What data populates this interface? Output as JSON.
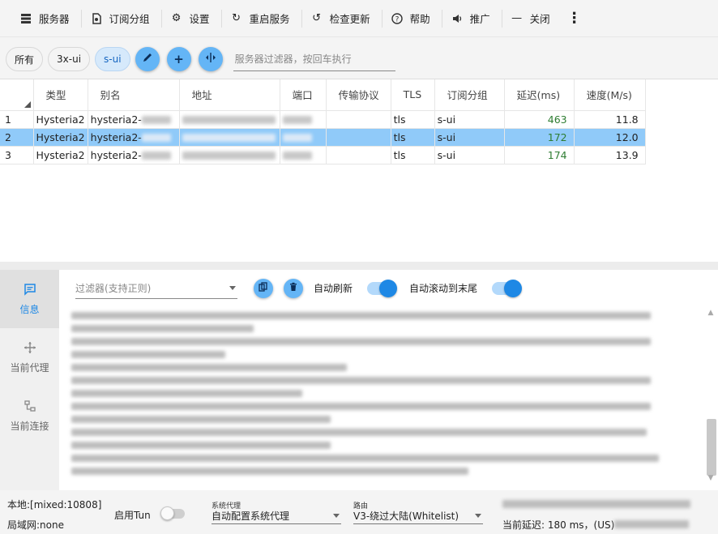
{
  "toolbar": {
    "items": [
      {
        "label": "服务器",
        "icon": "server-list-icon"
      },
      {
        "label": "订阅分组",
        "icon": "subscription-icon"
      },
      {
        "label": "设置",
        "icon": "gear-icon"
      },
      {
        "label": "重启服务",
        "icon": "restart-icon"
      },
      {
        "label": "检查更新",
        "icon": "update-icon"
      },
      {
        "label": "帮助",
        "icon": "help-icon"
      },
      {
        "label": "推广",
        "icon": "speaker-icon"
      },
      {
        "label": "关闭",
        "icon": "minus-icon"
      }
    ]
  },
  "chips": {
    "all": "所有",
    "g1": "3x-ui",
    "g2": "s-ui",
    "selected": "s-ui"
  },
  "server_filter": {
    "placeholder": "服务器过滤器，按回车执行"
  },
  "table": {
    "headers": [
      "类型",
      "别名",
      "地址",
      "端口",
      "传输协议",
      "TLS",
      "订阅分组",
      "延迟(ms)",
      "速度(M/s)"
    ],
    "rows": [
      {
        "no": "1",
        "type": "Hysteria2",
        "alias": "hysteria2-",
        "tls": "tls",
        "group": "s-ui",
        "latency": "463",
        "speed": "11.8"
      },
      {
        "no": "2",
        "type": "Hysteria2",
        "alias": "hysteria2-",
        "tls": "tls",
        "group": "s-ui",
        "latency": "172",
        "speed": "12.0"
      },
      {
        "no": "3",
        "type": "Hysteria2",
        "alias": "hysteria2-",
        "tls": "tls",
        "group": "s-ui",
        "latency": "174",
        "speed": "13.9"
      }
    ],
    "selected_row": 2
  },
  "sidenav": {
    "items": [
      {
        "label": "信息",
        "icon": "message-icon"
      },
      {
        "label": "当前代理",
        "icon": "proxy-icon"
      },
      {
        "label": "当前连接",
        "icon": "connection-icon"
      }
    ]
  },
  "log": {
    "filter_placeholder": "过滤器(支持正则)",
    "auto_refresh": "自动刷新",
    "auto_scroll": "自动滚动到末尾"
  },
  "status": {
    "local": "本地:[mixed:10808]",
    "lan": "局域网:none",
    "tun_label": "启用Tun",
    "sys_proxy_caption": "系统代理",
    "sys_proxy_value": "自动配置系统代理",
    "route_caption": "路由",
    "route_value": "V3-绕过大陆(Whitelist)",
    "delay": "当前延迟: 180 ms，(US)"
  },
  "colors": {
    "accent": "#1e88e5",
    "selected_row": "#90caf9",
    "fab": "#64b5f6",
    "latency_good": "#2e7d32"
  }
}
